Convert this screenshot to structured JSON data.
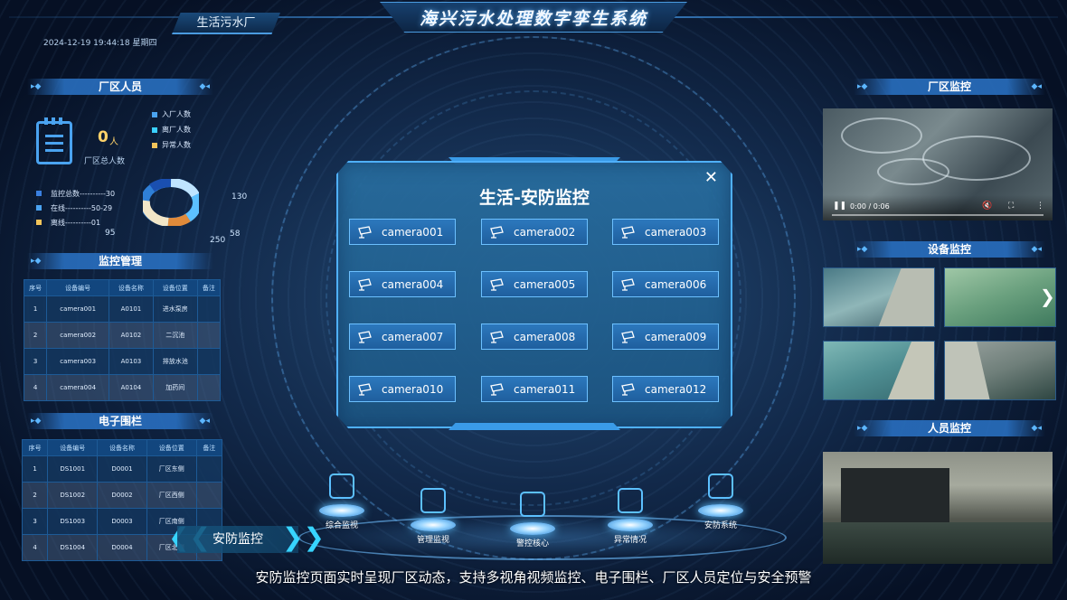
{
  "header": {
    "title": "海兴污水处理数字孪生系统",
    "site_tab": "生活污水厂",
    "datetime": "2024-12-19 19:44:18 星期四"
  },
  "staff": {
    "title": "厂区人员",
    "total_value": "0",
    "total_unit": "人",
    "total_label": "厂区总人数",
    "legend": [
      {
        "label": "入厂人数",
        "color": "#4aa3f0"
      },
      {
        "label": "离厂人数",
        "color": "#3ad0ff"
      },
      {
        "label": "异常人数",
        "color": "#f2c45a"
      }
    ]
  },
  "monitor_stats": {
    "legend": [
      {
        "label": "监控总数----------30",
        "color": "#3a7fe0"
      },
      {
        "label": "在线----------50-29",
        "color": "#4aa3f0"
      },
      {
        "label": "离线----------01",
        "color": "#f2c45a"
      }
    ],
    "pie_labels": {
      "l95": "95",
      "l130": "130",
      "l58": "58",
      "l250": "250"
    }
  },
  "monitor_table": {
    "title": "监控管理",
    "columns": [
      "序号",
      "设备编号",
      "设备名称",
      "设备位置",
      "备注"
    ],
    "rows": [
      [
        "1",
        "camera001",
        "A0101",
        "进水泵房",
        ""
      ],
      [
        "2",
        "camera002",
        "A0102",
        "二沉池",
        ""
      ],
      [
        "3",
        "camera003",
        "A0103",
        "排放水池",
        ""
      ],
      [
        "4",
        "camera004",
        "A0104",
        "加药间",
        ""
      ]
    ]
  },
  "fence_table": {
    "title": "电子围栏",
    "columns": [
      "序号",
      "设备编号",
      "设备名称",
      "设备位置",
      "备注"
    ],
    "rows": [
      [
        "1",
        "DS1001",
        "D0001",
        "厂区东侧",
        ""
      ],
      [
        "2",
        "DS1002",
        "D0002",
        "厂区西侧",
        ""
      ],
      [
        "3",
        "DS1003",
        "D0003",
        "厂区南侧",
        ""
      ],
      [
        "4",
        "DS1004",
        "D0004",
        "厂区北侧",
        ""
      ]
    ]
  },
  "modal": {
    "title": "生活-安防监控",
    "close": "✕",
    "cameras": [
      "camera001",
      "camera002",
      "camera003",
      "camera004",
      "camera005",
      "camera006",
      "camera007",
      "camera008",
      "camera009",
      "camera010",
      "camera011",
      "camera012"
    ]
  },
  "right": {
    "plant_monitor_title": "厂区监控",
    "video_time": "0:00 / 0:06",
    "device_monitor_title": "设备监控",
    "person_monitor_title": "人员监控"
  },
  "nav": {
    "items": [
      "综合监视",
      "管理监视",
      "警控核心",
      "异常情况",
      "安防系统"
    ]
  },
  "mode_banner": "安防监控",
  "caption": "安防监控页面实时呈现厂区动态，支持多视角视频监控、电子围栏、厂区人员定位与安全预警"
}
